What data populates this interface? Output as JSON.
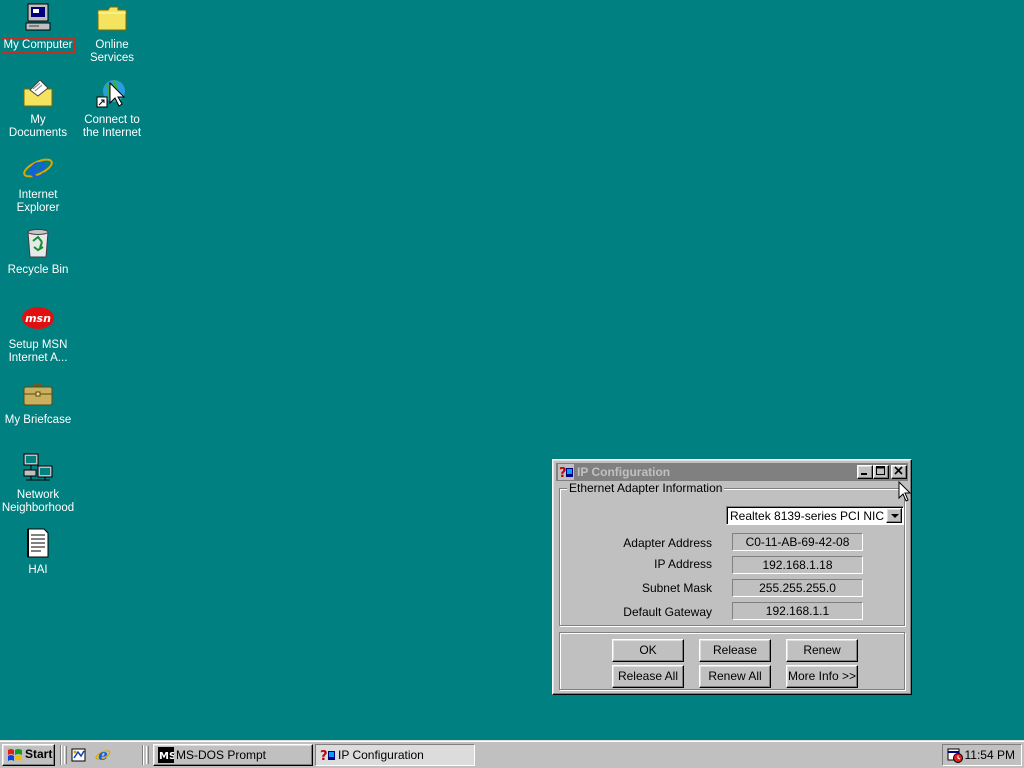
{
  "desktop": {
    "icons": [
      {
        "label": "My Computer"
      },
      {
        "label": "Online Services"
      },
      {
        "label": "My Documents"
      },
      {
        "label": "Connect to the Internet"
      },
      {
        "label": "Internet Explorer"
      },
      {
        "label": "Recycle Bin"
      },
      {
        "label": "Setup MSN Internet A..."
      },
      {
        "label": "My Briefcase"
      },
      {
        "label": "Network Neighborhood"
      },
      {
        "label": "HAI"
      }
    ]
  },
  "dialog": {
    "title": "IP Configuration",
    "group_title": "Ethernet  Adapter Information",
    "adapter_selected": "Realtek 8139-series PCI NIC",
    "fields": [
      {
        "label": "Adapter Address",
        "value": "C0-11-AB-69-42-08"
      },
      {
        "label": "IP Address",
        "value": "192.168.1.18"
      },
      {
        "label": "Subnet Mask",
        "value": "255.255.255.0"
      },
      {
        "label": "Default Gateway",
        "value": "192.168.1.1"
      }
    ],
    "buttons": {
      "ok": "OK",
      "release": "Release",
      "renew": "Renew",
      "release_all": "Release All",
      "renew_all": "Renew All",
      "more_info": "More Info >>"
    }
  },
  "taskbar": {
    "start_label": "Start",
    "tasks": [
      {
        "label": "MS-DOS Prompt"
      },
      {
        "label": "IP Configuration"
      }
    ],
    "clock": "11:54 PM"
  },
  "colors": {
    "desktop": "#008080",
    "face": "#c0c0c0",
    "inactive_title": "#808080"
  }
}
